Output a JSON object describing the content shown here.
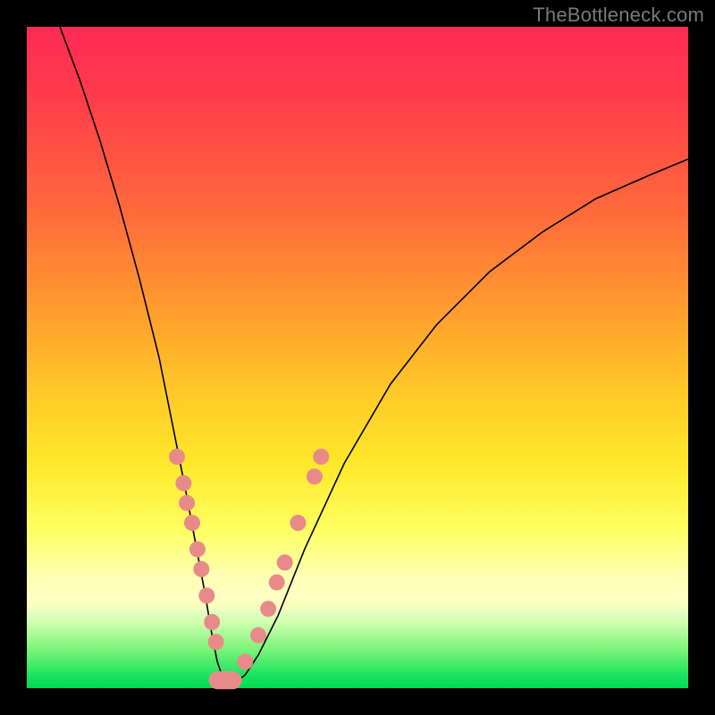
{
  "watermark": "TheBottleneck.com",
  "colors": {
    "frame": "#000000",
    "marker": "#e98a8a",
    "curve": "#000000"
  },
  "chart_data": {
    "type": "line",
    "title": "",
    "xlabel": "",
    "ylabel": "",
    "xlim": [
      0,
      100
    ],
    "ylim": [
      0,
      100
    ],
    "grid": false,
    "legend": false,
    "series": [
      {
        "name": "bottleneck-curve",
        "x": [
          5,
          8,
          11,
          14,
          17,
          20,
          22,
          24,
          25.5,
          27,
          28,
          28.8,
          29.5,
          30,
          30.5,
          31,
          32,
          33,
          35,
          38,
          42,
          48,
          55,
          62,
          70,
          78,
          86,
          94,
          100
        ],
        "y": [
          100,
          92,
          83,
          73,
          62,
          50,
          40,
          30,
          22,
          14,
          8,
          4,
          2,
          1.2,
          1,
          1,
          1.2,
          2,
          5,
          11,
          21,
          34,
          46,
          55,
          63,
          69,
          74,
          77.5,
          80
        ]
      }
    ],
    "markers_left_branch": [
      {
        "x": 22.7,
        "y": 35
      },
      {
        "x": 23.7,
        "y": 31
      },
      {
        "x": 24.2,
        "y": 28
      },
      {
        "x": 25.0,
        "y": 25
      },
      {
        "x": 25.8,
        "y": 21
      },
      {
        "x": 26.4,
        "y": 18
      },
      {
        "x": 27.2,
        "y": 14
      },
      {
        "x": 28.0,
        "y": 10
      },
      {
        "x": 28.6,
        "y": 7
      }
    ],
    "markers_right_branch": [
      {
        "x": 33.0,
        "y": 4
      },
      {
        "x": 35.0,
        "y": 8
      },
      {
        "x": 36.5,
        "y": 12
      },
      {
        "x": 37.8,
        "y": 16
      },
      {
        "x": 39.0,
        "y": 19
      },
      {
        "x": 41.0,
        "y": 25
      },
      {
        "x": 43.5,
        "y": 32
      },
      {
        "x": 44.5,
        "y": 35
      }
    ],
    "bottom_pill": {
      "x_start": 27.5,
      "x_end": 32.5,
      "y": 1.2
    }
  }
}
